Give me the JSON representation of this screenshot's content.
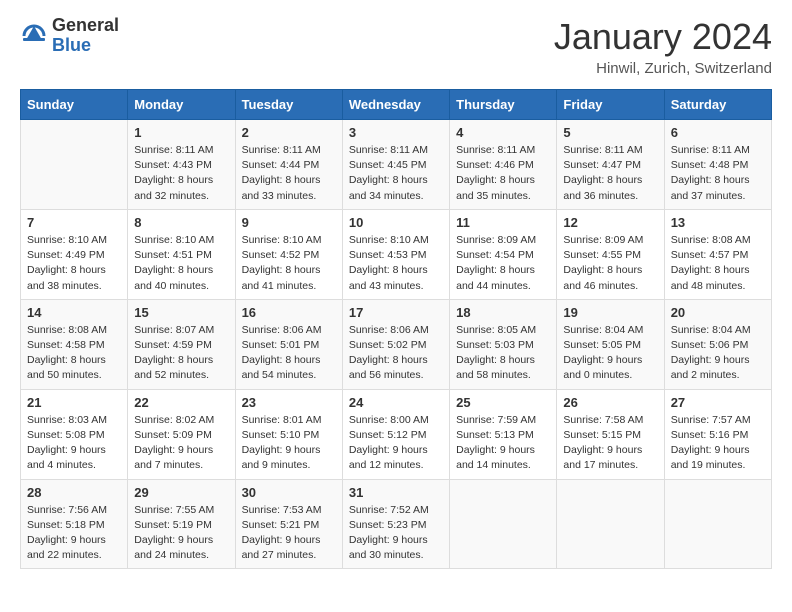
{
  "header": {
    "logo_general": "General",
    "logo_blue": "Blue",
    "title": "January 2024",
    "location": "Hinwil, Zurich, Switzerland"
  },
  "weekdays": [
    "Sunday",
    "Monday",
    "Tuesday",
    "Wednesday",
    "Thursday",
    "Friday",
    "Saturday"
  ],
  "weeks": [
    [
      {
        "day": "",
        "sunrise": "",
        "sunset": "",
        "daylight": ""
      },
      {
        "day": "1",
        "sunrise": "Sunrise: 8:11 AM",
        "sunset": "Sunset: 4:43 PM",
        "daylight": "Daylight: 8 hours and 32 minutes."
      },
      {
        "day": "2",
        "sunrise": "Sunrise: 8:11 AM",
        "sunset": "Sunset: 4:44 PM",
        "daylight": "Daylight: 8 hours and 33 minutes."
      },
      {
        "day": "3",
        "sunrise": "Sunrise: 8:11 AM",
        "sunset": "Sunset: 4:45 PM",
        "daylight": "Daylight: 8 hours and 34 minutes."
      },
      {
        "day": "4",
        "sunrise": "Sunrise: 8:11 AM",
        "sunset": "Sunset: 4:46 PM",
        "daylight": "Daylight: 8 hours and 35 minutes."
      },
      {
        "day": "5",
        "sunrise": "Sunrise: 8:11 AM",
        "sunset": "Sunset: 4:47 PM",
        "daylight": "Daylight: 8 hours and 36 minutes."
      },
      {
        "day": "6",
        "sunrise": "Sunrise: 8:11 AM",
        "sunset": "Sunset: 4:48 PM",
        "daylight": "Daylight: 8 hours and 37 minutes."
      }
    ],
    [
      {
        "day": "7",
        "sunrise": "Sunrise: 8:10 AM",
        "sunset": "Sunset: 4:49 PM",
        "daylight": "Daylight: 8 hours and 38 minutes."
      },
      {
        "day": "8",
        "sunrise": "Sunrise: 8:10 AM",
        "sunset": "Sunset: 4:51 PM",
        "daylight": "Daylight: 8 hours and 40 minutes."
      },
      {
        "day": "9",
        "sunrise": "Sunrise: 8:10 AM",
        "sunset": "Sunset: 4:52 PM",
        "daylight": "Daylight: 8 hours and 41 minutes."
      },
      {
        "day": "10",
        "sunrise": "Sunrise: 8:10 AM",
        "sunset": "Sunset: 4:53 PM",
        "daylight": "Daylight: 8 hours and 43 minutes."
      },
      {
        "day": "11",
        "sunrise": "Sunrise: 8:09 AM",
        "sunset": "Sunset: 4:54 PM",
        "daylight": "Daylight: 8 hours and 44 minutes."
      },
      {
        "day": "12",
        "sunrise": "Sunrise: 8:09 AM",
        "sunset": "Sunset: 4:55 PM",
        "daylight": "Daylight: 8 hours and 46 minutes."
      },
      {
        "day": "13",
        "sunrise": "Sunrise: 8:08 AM",
        "sunset": "Sunset: 4:57 PM",
        "daylight": "Daylight: 8 hours and 48 minutes."
      }
    ],
    [
      {
        "day": "14",
        "sunrise": "Sunrise: 8:08 AM",
        "sunset": "Sunset: 4:58 PM",
        "daylight": "Daylight: 8 hours and 50 minutes."
      },
      {
        "day": "15",
        "sunrise": "Sunrise: 8:07 AM",
        "sunset": "Sunset: 4:59 PM",
        "daylight": "Daylight: 8 hours and 52 minutes."
      },
      {
        "day": "16",
        "sunrise": "Sunrise: 8:06 AM",
        "sunset": "Sunset: 5:01 PM",
        "daylight": "Daylight: 8 hours and 54 minutes."
      },
      {
        "day": "17",
        "sunrise": "Sunrise: 8:06 AM",
        "sunset": "Sunset: 5:02 PM",
        "daylight": "Daylight: 8 hours and 56 minutes."
      },
      {
        "day": "18",
        "sunrise": "Sunrise: 8:05 AM",
        "sunset": "Sunset: 5:03 PM",
        "daylight": "Daylight: 8 hours and 58 minutes."
      },
      {
        "day": "19",
        "sunrise": "Sunrise: 8:04 AM",
        "sunset": "Sunset: 5:05 PM",
        "daylight": "Daylight: 9 hours and 0 minutes."
      },
      {
        "day": "20",
        "sunrise": "Sunrise: 8:04 AM",
        "sunset": "Sunset: 5:06 PM",
        "daylight": "Daylight: 9 hours and 2 minutes."
      }
    ],
    [
      {
        "day": "21",
        "sunrise": "Sunrise: 8:03 AM",
        "sunset": "Sunset: 5:08 PM",
        "daylight": "Daylight: 9 hours and 4 minutes."
      },
      {
        "day": "22",
        "sunrise": "Sunrise: 8:02 AM",
        "sunset": "Sunset: 5:09 PM",
        "daylight": "Daylight: 9 hours and 7 minutes."
      },
      {
        "day": "23",
        "sunrise": "Sunrise: 8:01 AM",
        "sunset": "Sunset: 5:10 PM",
        "daylight": "Daylight: 9 hours and 9 minutes."
      },
      {
        "day": "24",
        "sunrise": "Sunrise: 8:00 AM",
        "sunset": "Sunset: 5:12 PM",
        "daylight": "Daylight: 9 hours and 12 minutes."
      },
      {
        "day": "25",
        "sunrise": "Sunrise: 7:59 AM",
        "sunset": "Sunset: 5:13 PM",
        "daylight": "Daylight: 9 hours and 14 minutes."
      },
      {
        "day": "26",
        "sunrise": "Sunrise: 7:58 AM",
        "sunset": "Sunset: 5:15 PM",
        "daylight": "Daylight: 9 hours and 17 minutes."
      },
      {
        "day": "27",
        "sunrise": "Sunrise: 7:57 AM",
        "sunset": "Sunset: 5:16 PM",
        "daylight": "Daylight: 9 hours and 19 minutes."
      }
    ],
    [
      {
        "day": "28",
        "sunrise": "Sunrise: 7:56 AM",
        "sunset": "Sunset: 5:18 PM",
        "daylight": "Daylight: 9 hours and 22 minutes."
      },
      {
        "day": "29",
        "sunrise": "Sunrise: 7:55 AM",
        "sunset": "Sunset: 5:19 PM",
        "daylight": "Daylight: 9 hours and 24 minutes."
      },
      {
        "day": "30",
        "sunrise": "Sunrise: 7:53 AM",
        "sunset": "Sunset: 5:21 PM",
        "daylight": "Daylight: 9 hours and 27 minutes."
      },
      {
        "day": "31",
        "sunrise": "Sunrise: 7:52 AM",
        "sunset": "Sunset: 5:23 PM",
        "daylight": "Daylight: 9 hours and 30 minutes."
      },
      {
        "day": "",
        "sunrise": "",
        "sunset": "",
        "daylight": ""
      },
      {
        "day": "",
        "sunrise": "",
        "sunset": "",
        "daylight": ""
      },
      {
        "day": "",
        "sunrise": "",
        "sunset": "",
        "daylight": ""
      }
    ]
  ]
}
